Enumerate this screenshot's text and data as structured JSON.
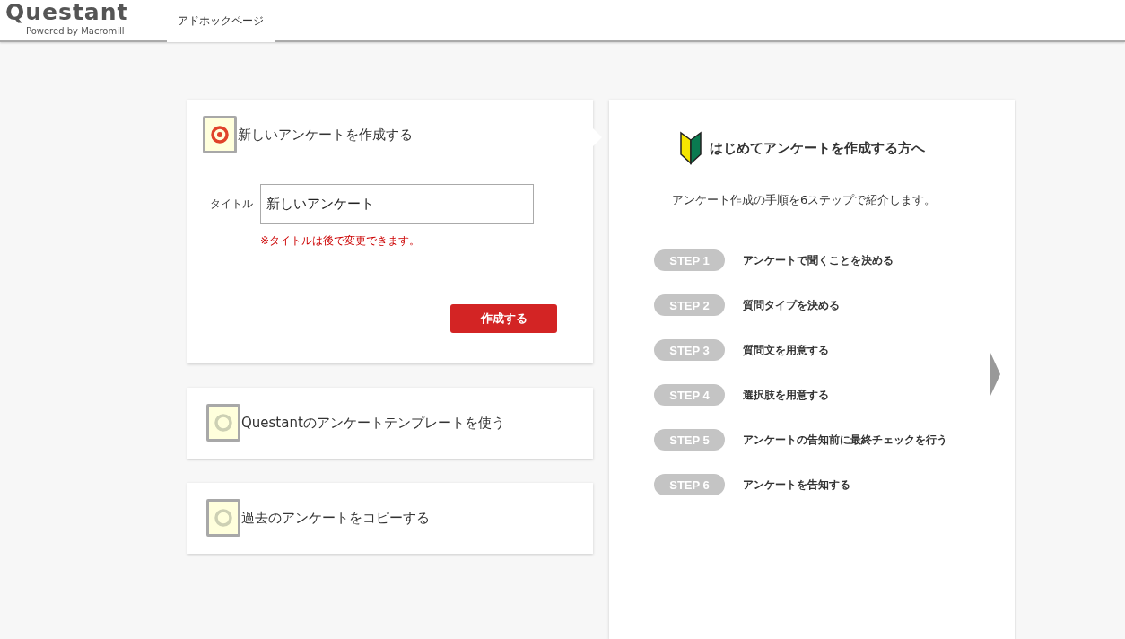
{
  "header": {
    "logo": "Questant",
    "logo_subtitle": "Powered by Macromill",
    "nav_tab": "アドホックページ"
  },
  "options": [
    {
      "label": "新しいアンケートを作成する",
      "selected": true
    },
    {
      "label": "Questantのアンケートテンプレートを使う",
      "selected": false
    },
    {
      "label": "過去のアンケートをコピーする",
      "selected": false
    }
  ],
  "form": {
    "title_label": "タイトル",
    "title_value": "新しいアンケート",
    "note": "※タイトルは後で変更できます。",
    "submit_button": "作成する"
  },
  "guide": {
    "title": "はじめてアンケートを作成する方へ",
    "intro": "アンケート作成の手順を6ステップで紹介します。",
    "steps": [
      {
        "badge": "STEP 1",
        "text": "アンケートで聞くことを決める"
      },
      {
        "badge": "STEP 2",
        "text": "質問タイプを決める"
      },
      {
        "badge": "STEP 3",
        "text": "質問文を用意する"
      },
      {
        "badge": "STEP 4",
        "text": "選択肢を用意する"
      },
      {
        "badge": "STEP 5",
        "text": "アンケートの告知前に最終チェックを行う"
      },
      {
        "badge": "STEP 6",
        "text": "アンケートを告知する"
      }
    ]
  }
}
